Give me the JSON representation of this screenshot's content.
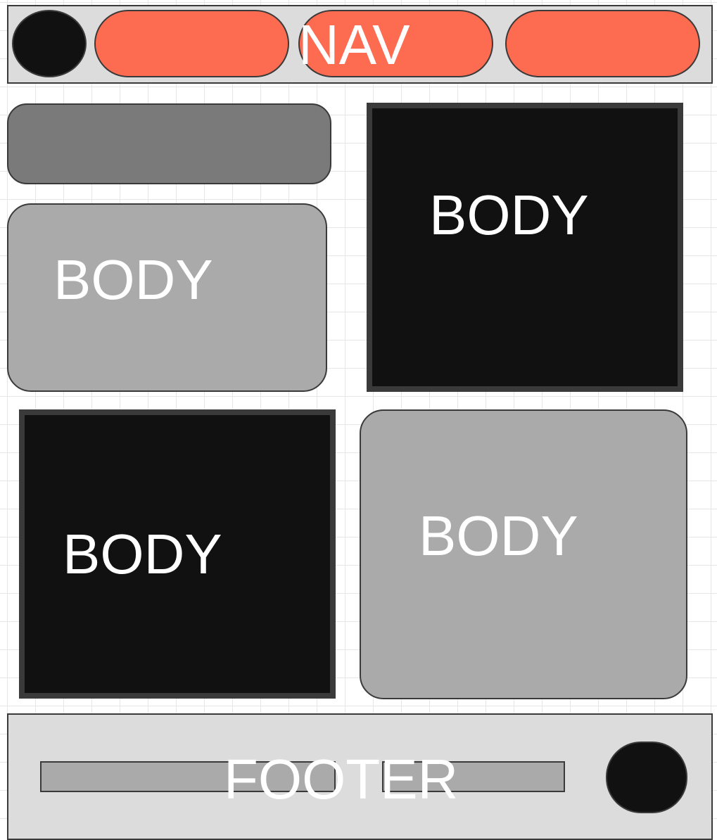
{
  "nav": {
    "label": "NAV",
    "logo_shape": "circle",
    "items": [
      "",
      "",
      ""
    ]
  },
  "body": {
    "cards": [
      {
        "label": "BODY"
      },
      {
        "label": "BODY"
      },
      {
        "label": "BODY"
      },
      {
        "label": "BODY"
      }
    ]
  },
  "footer": {
    "label": "FOOTER"
  },
  "colors": {
    "nav_pill": "#fd6c50",
    "dark_fill": "#111111",
    "light_fill": "#aaaaaa",
    "mid_fill": "#7a7a7a",
    "bar_fill": "#dcdcdc",
    "stroke": "#3a3a3a"
  }
}
